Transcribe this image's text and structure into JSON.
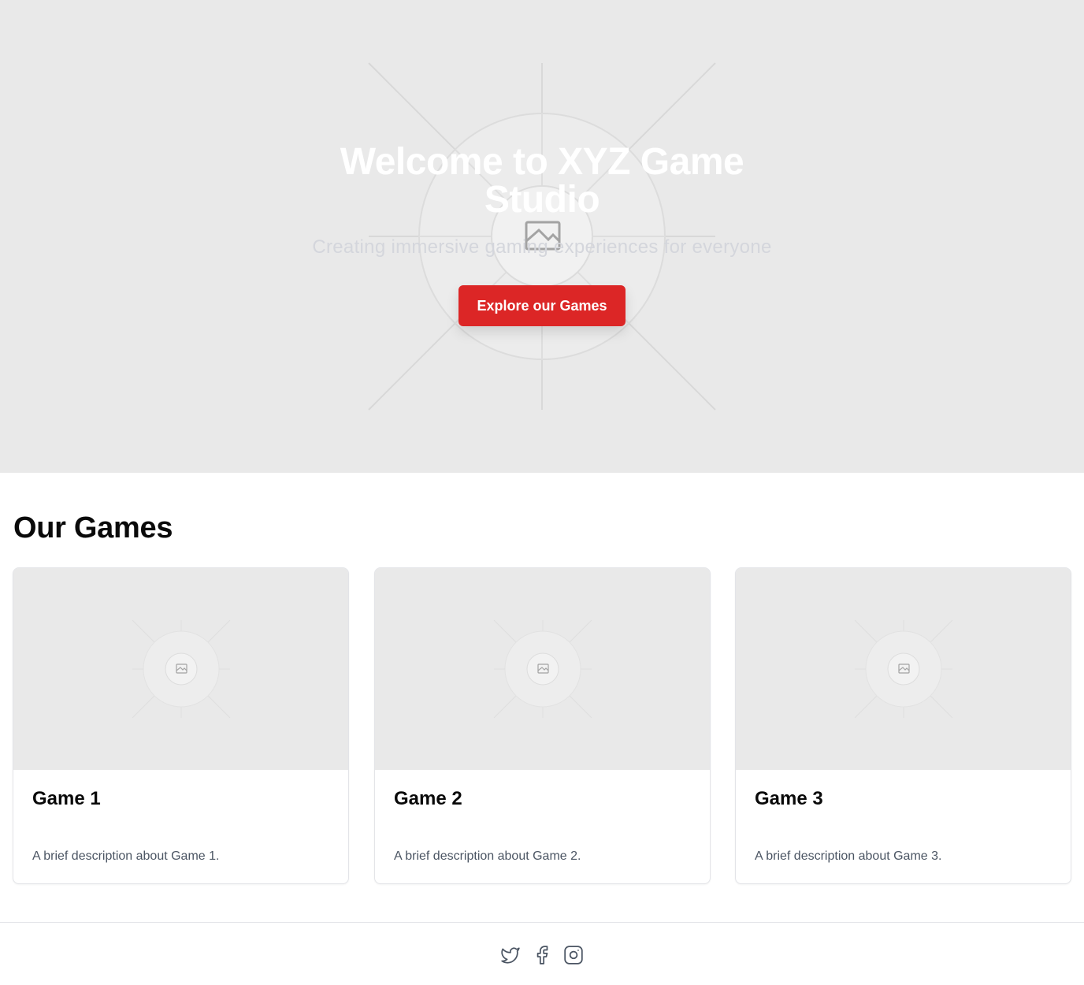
{
  "hero": {
    "title": "Welcome to XYZ Game Studio",
    "subtitle": "Creating immersive gaming experiences for everyone",
    "button_label": "Explore our Games",
    "background_icon": "image-placeholder-icon"
  },
  "games": {
    "heading": "Our Games",
    "items": [
      {
        "title": "Game 1",
        "description": "A brief description about Game 1.",
        "image_icon": "image-placeholder-icon"
      },
      {
        "title": "Game 2",
        "description": "A brief description about Game 2.",
        "image_icon": "image-placeholder-icon"
      },
      {
        "title": "Game 3",
        "description": "A brief description about Game 3.",
        "image_icon": "image-placeholder-icon"
      }
    ]
  },
  "footer": {
    "social_icons": [
      "twitter-icon",
      "facebook-icon",
      "instagram-icon"
    ]
  },
  "colors": {
    "accent": "#dc2626",
    "placeholder_bg": "#e9e9e9",
    "body_text": "#4b5563"
  }
}
